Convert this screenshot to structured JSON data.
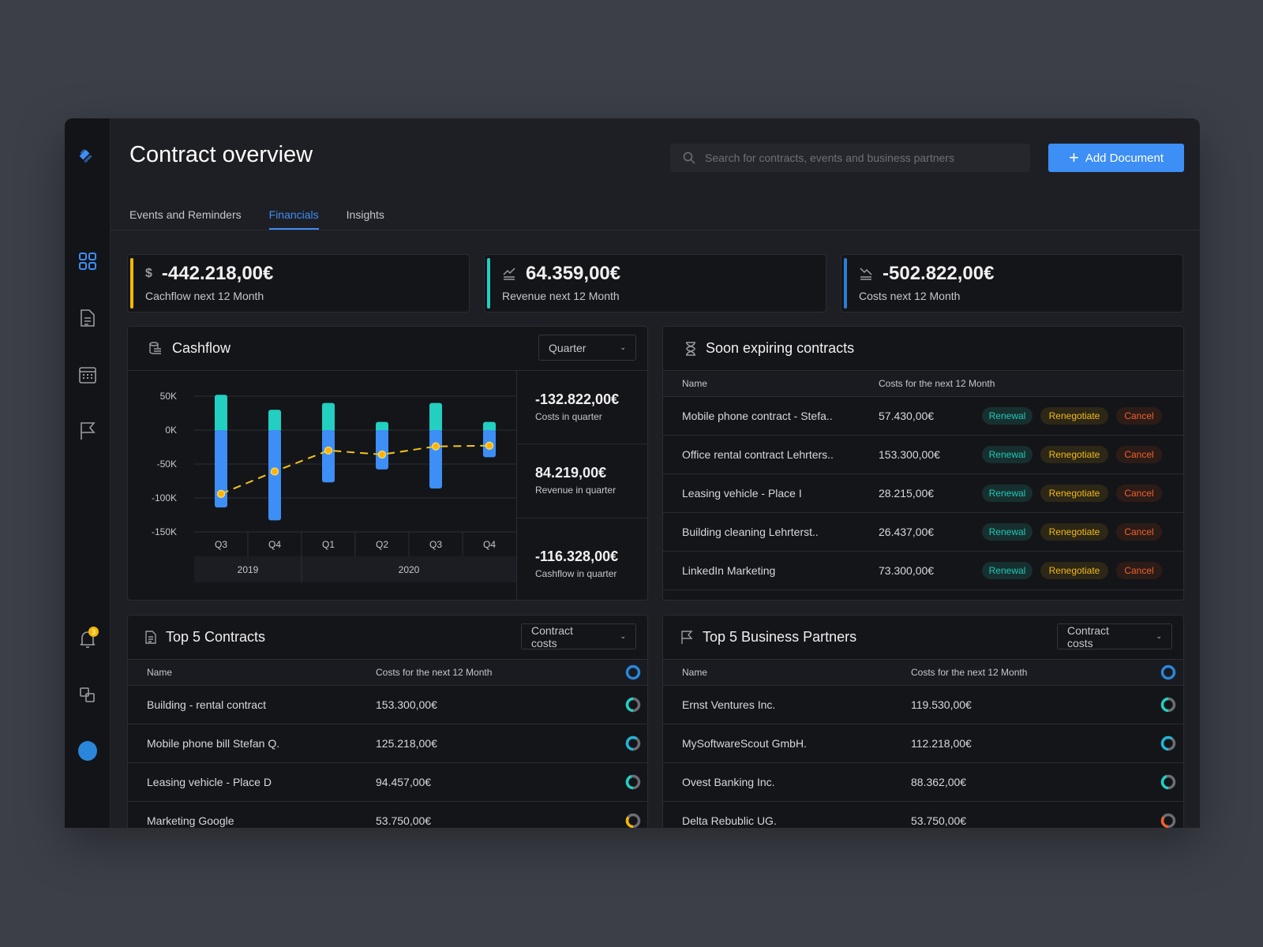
{
  "header": {
    "title": "Contract overview",
    "search_placeholder": "Search for contracts, events and business partners",
    "add_button": "Add Document"
  },
  "tabs": [
    {
      "label": "Events and Reminders"
    },
    {
      "label": "Financials",
      "active": true
    },
    {
      "label": "Insights"
    }
  ],
  "sidebar": {
    "notification_count": "3",
    "icons": [
      "logo",
      "dashboard-grid",
      "document",
      "calendar",
      "flag",
      "bell",
      "copy",
      "avatar"
    ]
  },
  "kpis": [
    {
      "value": "-442.218,00€",
      "label": "Cachflow next 12 Month",
      "color": "#f5b800",
      "icon": "cashflow-icon"
    },
    {
      "value": "64.359,00€",
      "label": "Revenue next 12 Month",
      "color": "#22cfc0",
      "icon": "revenue-icon"
    },
    {
      "value": "-502.822,00€",
      "label": "Costs next 12 Month",
      "color": "#2a7fd6",
      "icon": "costs-icon"
    }
  ],
  "cashflow": {
    "title": "Cashflow",
    "period_select": "Quarter",
    "stats": [
      {
        "value": "-132.822,00€",
        "label": "Costs in quarter"
      },
      {
        "value": "84.219,00€",
        "label": "Revenue in quarter"
      },
      {
        "value": "-116.328,00€",
        "label": "Cashflow in quarter"
      }
    ]
  },
  "chart_data": {
    "type": "bar",
    "categories": [
      "Q3",
      "Q4",
      "Q1",
      "Q2",
      "Q3",
      "Q4"
    ],
    "groups": [
      {
        "label": "2019",
        "span": 2
      },
      {
        "label": "2020",
        "span": 4
      }
    ],
    "y_ticks": [
      "50K",
      "0K",
      "-50K",
      "-100K",
      "-150K"
    ],
    "ylim": [
      -150,
      50
    ],
    "series": [
      {
        "key": "revenue",
        "values": [
          52,
          30,
          40,
          12,
          40,
          12
        ],
        "color": "#22cfc0"
      },
      {
        "key": "costs",
        "values": [
          -114,
          -133,
          -77,
          -58,
          -86,
          -40
        ],
        "color": "#3d8ef5"
      },
      {
        "key": "cashflow",
        "type": "line",
        "values": [
          -94,
          -61,
          -30,
          -36,
          -24,
          -23
        ],
        "color": "#f5c518"
      }
    ],
    "grid": true
  },
  "expiring": {
    "title": "Soon expiring contracts",
    "columns": [
      "Name",
      "Costs for the next 12 Month"
    ],
    "actions": {
      "renewal": "Renewal",
      "renegotiate": "Renegotiate",
      "cancel": "Cancel"
    },
    "rows": [
      {
        "name": "Mobile phone contract - Stefa..",
        "cost": "57.430,00€"
      },
      {
        "name": "Office rental contract Lehrters..",
        "cost": "153.300,00€"
      },
      {
        "name": "Leasing vehicle - Place I",
        "cost": "28.215,00€"
      },
      {
        "name": "Building cleaning Lehrterst..",
        "cost": "26.437,00€"
      },
      {
        "name": "LinkedIn Marketing",
        "cost": "73.300,00€"
      }
    ]
  },
  "top_contracts": {
    "title": "Top 5 Contracts",
    "select": "Contract costs",
    "columns": [
      "Name",
      "Costs for the next 12 Month"
    ],
    "rows": [
      {
        "name": "Building - rental contract",
        "cost": "153.300,00€",
        "share": 0.5,
        "color": "#22cfc0"
      },
      {
        "name": "Mobile phone bill Stefan Q.",
        "cost": "125.218,00€",
        "share": 0.6,
        "color": "#22b5d6"
      },
      {
        "name": "Leasing vehicle - Place D",
        "cost": "94.457,00€",
        "share": 0.45,
        "color": "#22cfc0"
      },
      {
        "name": "Marketing Google",
        "cost": "53.750,00€",
        "share": 0.35,
        "color": "#f5b800"
      }
    ]
  },
  "top_partners": {
    "title": "Top 5 Business Partners",
    "select": "Contract costs",
    "columns": [
      "Name",
      "Costs for the next 12 Month"
    ],
    "rows": [
      {
        "name": "Ernst Ventures Inc.",
        "cost": "119.530,00€",
        "share": 0.5,
        "color": "#22cfc0"
      },
      {
        "name": "MySoftwareScout GmbH.",
        "cost": "112.218,00€",
        "share": 0.6,
        "color": "#22b5d6"
      },
      {
        "name": "Ovest Banking Inc.",
        "cost": "88.362,00€",
        "share": 0.45,
        "color": "#22cfc0"
      },
      {
        "name": "Delta Rebublic UG.",
        "cost": "53.750,00€",
        "share": 0.35,
        "color": "#f0602a"
      }
    ]
  }
}
